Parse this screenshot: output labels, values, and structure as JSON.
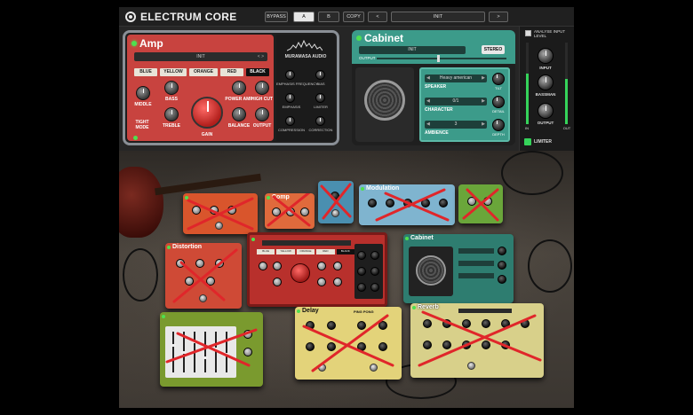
{
  "topbar": {
    "title": "ELECTRUM CORE",
    "bypass": "BYPASS",
    "preset_a": "A",
    "preset_b": "B",
    "copy": "COPY",
    "prev": "<",
    "preset_name": "INIT",
    "next": ">"
  },
  "amp": {
    "title": "Amp",
    "preset": "INIT",
    "preset_arrows": "< >",
    "colors": [
      "BLUE",
      "YELLOW",
      "ORANGE",
      "RED",
      "BLACK"
    ],
    "selected_color": "BLACK",
    "knobs": {
      "middle": "MIDDLE",
      "bass": "BASS",
      "treble": "TREBLE",
      "gain": "GAIN",
      "power_amp": "POWER AMP",
      "high_cut": "HIGH CUT",
      "balance": "BALANCE",
      "output": "OUTPUT"
    },
    "tight_mode": "TIGHT MODE",
    "brand": "MURAMASA AUDIO",
    "side_knobs": {
      "emphasis_freq": "EMPHASIS FREQUENCY",
      "bias": "BIAS",
      "emphasis": "EMPHASIS",
      "limiter": "LIMITER",
      "compression": "COMPRESSION",
      "correction": "CORRECTION"
    }
  },
  "cabinet": {
    "title": "Cabinet",
    "preset": "INIT",
    "stereo": "STEREO",
    "output": "OUTPUT",
    "speaker_value": "Heavy american",
    "speaker": "SPEAKER",
    "character_value": "0/1",
    "character": "CHARACTER",
    "ambience_value": "3",
    "ambience": "AMBIENCE",
    "tilt": "TILT",
    "detail": "DETAIL",
    "depth": "DEPTH"
  },
  "side": {
    "analyse": "ANALYSE INPUT LEVEL",
    "input": "INPUT",
    "bassman": "BASSMAN",
    "output": "OUTPUT",
    "in": "IN",
    "out": "OUT",
    "in_level": 0.62,
    "out_level": 0.55,
    "limiter": "LIMITER"
  },
  "pedals": {
    "comp": "Comp",
    "modulation": "Modulation",
    "distortion": "Distortion",
    "cabinet": "Cabinet",
    "delay": "Delay",
    "reverb": "Reverb",
    "ping_pong": "PING PONG",
    "amp_colors": [
      "BLUE",
      "YELLOW",
      "ORANGE",
      "RED",
      "BLACK"
    ]
  },
  "colors": {
    "amp_red": "#c8433f",
    "cabinet_teal": "#3c9b8a",
    "led_green": "#4fe04f",
    "cross_red": "#e0262a"
  }
}
